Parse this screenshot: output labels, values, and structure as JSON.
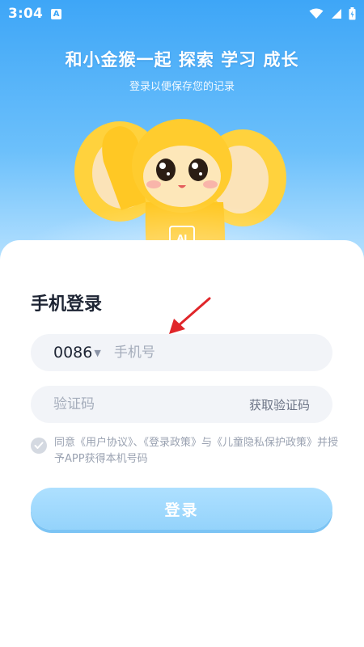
{
  "status_bar": {
    "time": "3:04",
    "notification_badge": "A"
  },
  "hero": {
    "title": "和小金猴一起 探索 学习 成长",
    "subtitle": "登录以便保存您的记录",
    "mascot_badge": "AI"
  },
  "login": {
    "title": "手机登录",
    "country_code": "0086",
    "phone_placeholder": "手机号",
    "code_placeholder": "验证码",
    "get_code_label": "获取验证码",
    "agreement_text": "同意《用户协议》、《登录政策》与《儿童隐私保护政策》并授予APP获得本机号码",
    "login_button": "登录"
  },
  "colors": {
    "hero_gradient_top": "#3ea6f7",
    "button_blue": "#94d3fb",
    "arrow_red": "#e0262a"
  }
}
